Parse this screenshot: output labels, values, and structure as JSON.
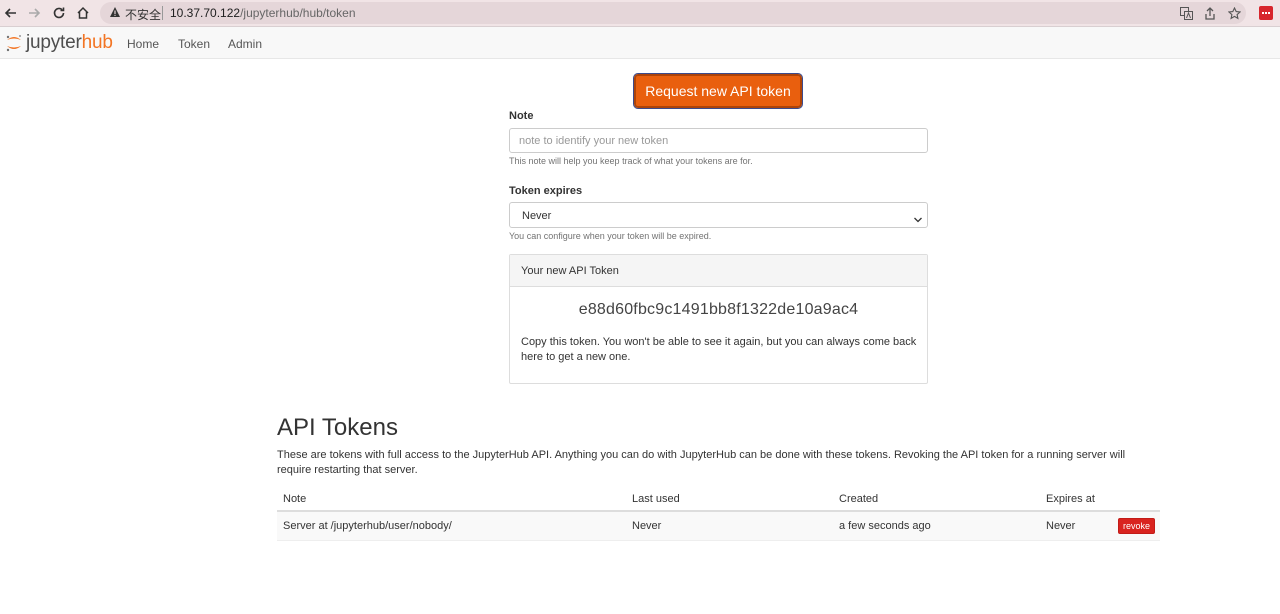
{
  "browser": {
    "insecure_label": "不安全",
    "url_host": "10.37.70.122",
    "url_path": "/jupyterhub/hub/token"
  },
  "navbar": {
    "logo_part1": "jupyter",
    "logo_part2": "hub",
    "links": [
      "Home",
      "Token",
      "Admin"
    ]
  },
  "request": {
    "button_label": "Request new API token",
    "note_label": "Note",
    "note_placeholder": "note to identify your new token",
    "note_help": "This note will help you keep track of what your tokens are for.",
    "expires_label": "Token expires",
    "expires_value": "Never",
    "expires_help": "You can configure when your token will be expired."
  },
  "new_token": {
    "heading": "Your new API Token",
    "value": "e88d60fbc9c1491bb8f1322de10a9ac4",
    "note": "Copy this token. You won't be able to see it again, but you can always come back here to get a new one."
  },
  "api_tokens": {
    "title": "API Tokens",
    "description": "These are tokens with full access to the JupyterHub API. Anything you can do with JupyterHub can be done with these tokens. Revoking the API token for a running server will require restarting that server.",
    "columns": [
      "Note",
      "Last used",
      "Created",
      "Expires at"
    ],
    "rows": [
      {
        "note": "Server at /jupyterhub/user/nobody/",
        "last_used": "Never",
        "created": "a few seconds ago",
        "expires": "Never",
        "action": "revoke"
      }
    ]
  },
  "colors": {
    "accent": "#e95f0e",
    "danger": "#d9231f",
    "logo_orange": "#f37524"
  }
}
